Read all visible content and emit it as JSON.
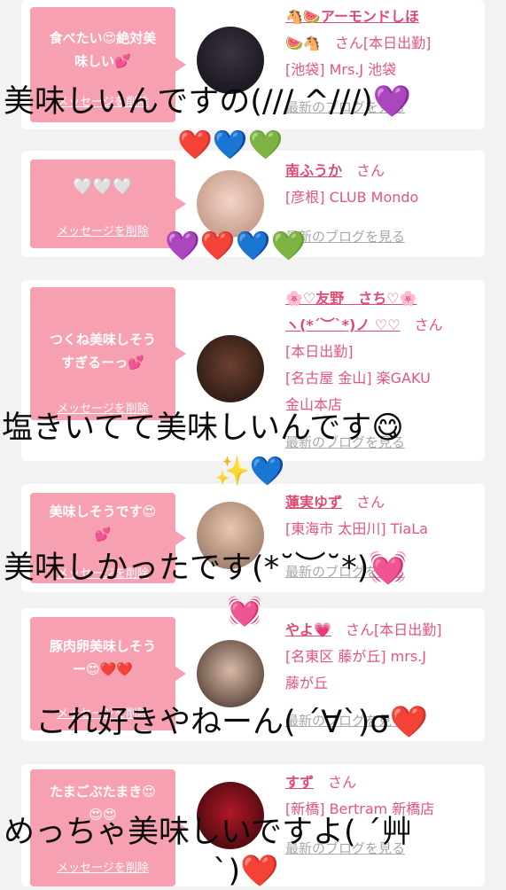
{
  "cards": [
    {
      "bubble_lines": [
        "食べたい😍絶対美",
        "味しい💕"
      ],
      "delete_label": "メッセージを削除",
      "name": "🐴🍉アーモンドしほ",
      "info_lines": [
        "🍉🐴　さん[本日出勤]",
        "[池袋] Mrs.J 池袋"
      ],
      "blog_label": "最新のブログを見る"
    },
    {
      "bubble_lines": [
        "🤍🤍🤍"
      ],
      "delete_label": "メッセージを削除",
      "name": "南ふうか",
      "name_suffix": "さん",
      "info_lines": [
        "[彦根] CLUB Mondo"
      ],
      "blog_label": "最新のブログを見る"
    },
    {
      "bubble_lines": [
        "つくね美味しそう",
        "すぎるーっ💕"
      ],
      "delete_label": "メッセージを削除",
      "name": "🌸♡友野　さち♡🌸",
      "name2": "ヽ(*´︶`*)ノ ♡♡",
      "name_suffix": "さん",
      "info_lines": [
        "[本日出勤]",
        "[名古屋 金山] 楽GAKU",
        "金山本店"
      ],
      "blog_label": "最新のブログを見る"
    },
    {
      "bubble_lines": [
        "美味しそうです😍",
        "💕"
      ],
      "delete_label": "メッセージを削除",
      "name": "蓮実ゆず",
      "name_suffix": "さん",
      "info_lines": [
        "[東海市 太田川] TiaLa"
      ],
      "blog_label": "最新のブログを見る"
    },
    {
      "bubble_lines": [
        "豚肉卵美味しそう",
        "ー😍❤️❤️"
      ],
      "delete_label": "メッセージを削除",
      "name": "やよ💗",
      "name_suffix": "さん[本日出勤]",
      "info_lines": [
        "[名東区 藤が丘] mrs.J",
        "藤が丘"
      ],
      "blog_label": "最新のブログを見る"
    },
    {
      "bubble_lines": [
        "たまごぶたまき😍",
        "😍😍"
      ],
      "delete_label": "メッセージを削除",
      "name": "すず",
      "name_suffix": "さん",
      "info_lines": [
        "[新橋] Bertram 新橋店"
      ],
      "blog_label": "最新のブログを見る"
    }
  ],
  "overlays": {
    "line1": "美味しいんですの(/// ^///)💜",
    "line1b": "❤️💙💚",
    "line2": "💜❤️💙💚",
    "line3": "塩きいてて美味しいんです😋",
    "line3b": "✨💙",
    "line4": "美味しかったです(*˘︶˘*)💓",
    "line4b": "💓",
    "line5": "これ好きやねーん( ´∀`)σ❤️",
    "line6": "めっちゃ美味しいですよ( ´艸",
    "line6b": "`)❤️"
  }
}
